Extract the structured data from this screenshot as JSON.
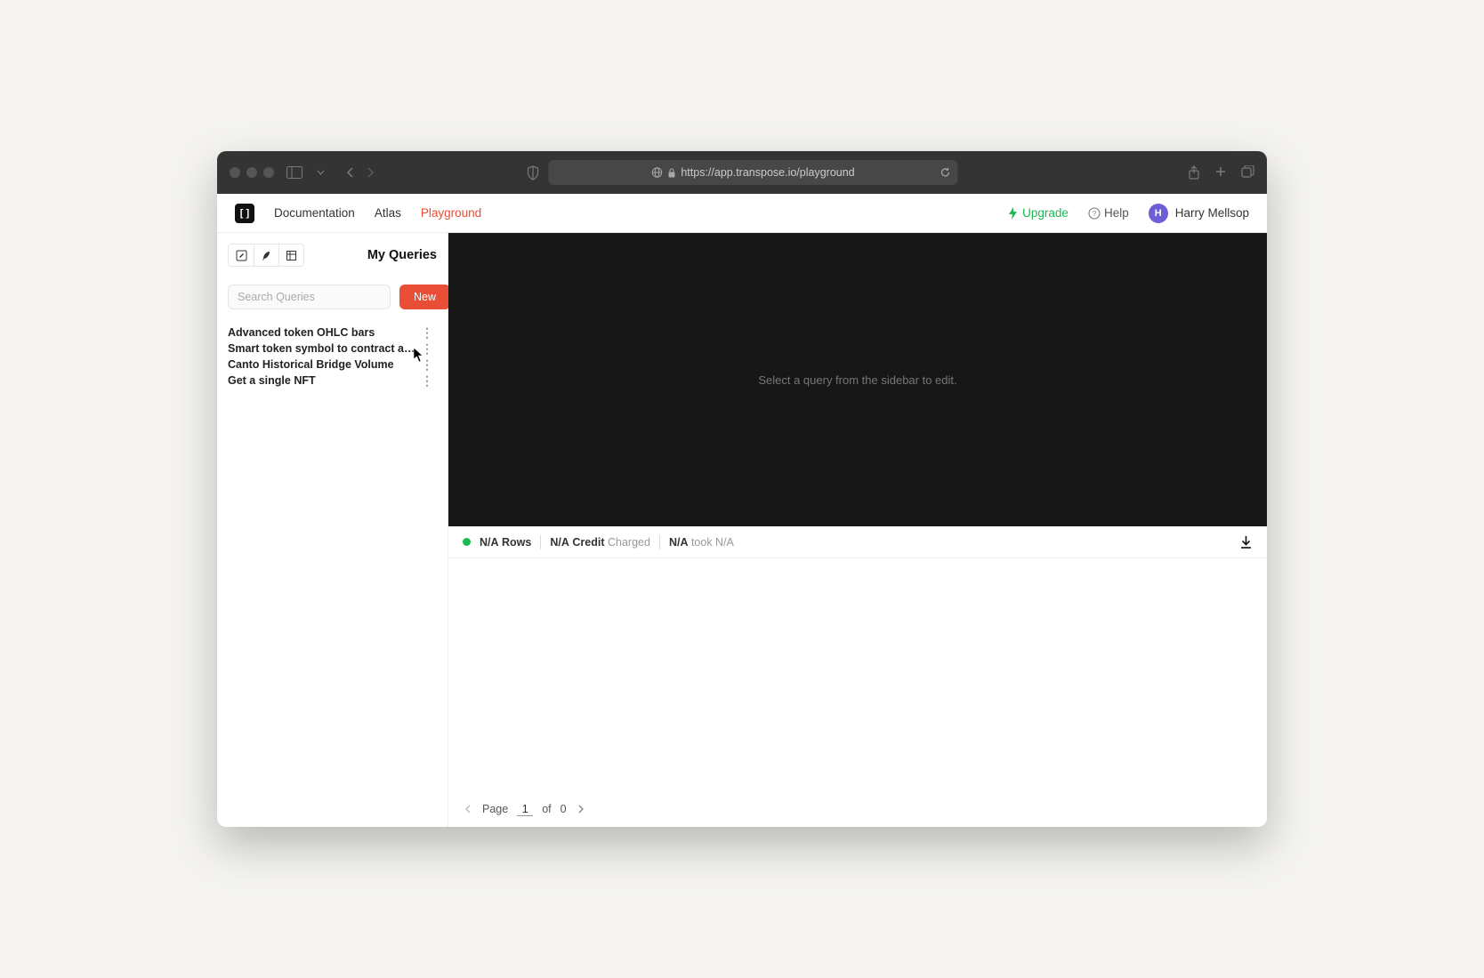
{
  "browser": {
    "url": "https://app.transpose.io/playground"
  },
  "nav": {
    "links": [
      "Documentation",
      "Atlas",
      "Playground"
    ],
    "upgrade": "Upgrade",
    "help": "Help",
    "user_initial": "H",
    "user_name": "Harry Mellsop"
  },
  "sidebar": {
    "title": "My Queries",
    "search_placeholder": "Search Queries",
    "new_label": "New",
    "items": [
      "Advanced token OHLC bars",
      "Smart token symbol to contract addr…",
      "Canto Historical Bridge Volume",
      "Get a single NFT"
    ]
  },
  "editor": {
    "placeholder": "Select a query from the sidebar to edit."
  },
  "status": {
    "rows_value": "N/A",
    "rows_label": "Rows",
    "credit_value": "N/A",
    "credit_label": "Credit",
    "credit_suffix": "Charged",
    "time_value": "N/A",
    "time_suffix": "took N/A"
  },
  "pagination": {
    "label_page": "Page",
    "current": "1",
    "of_label": "of",
    "total": "0"
  }
}
